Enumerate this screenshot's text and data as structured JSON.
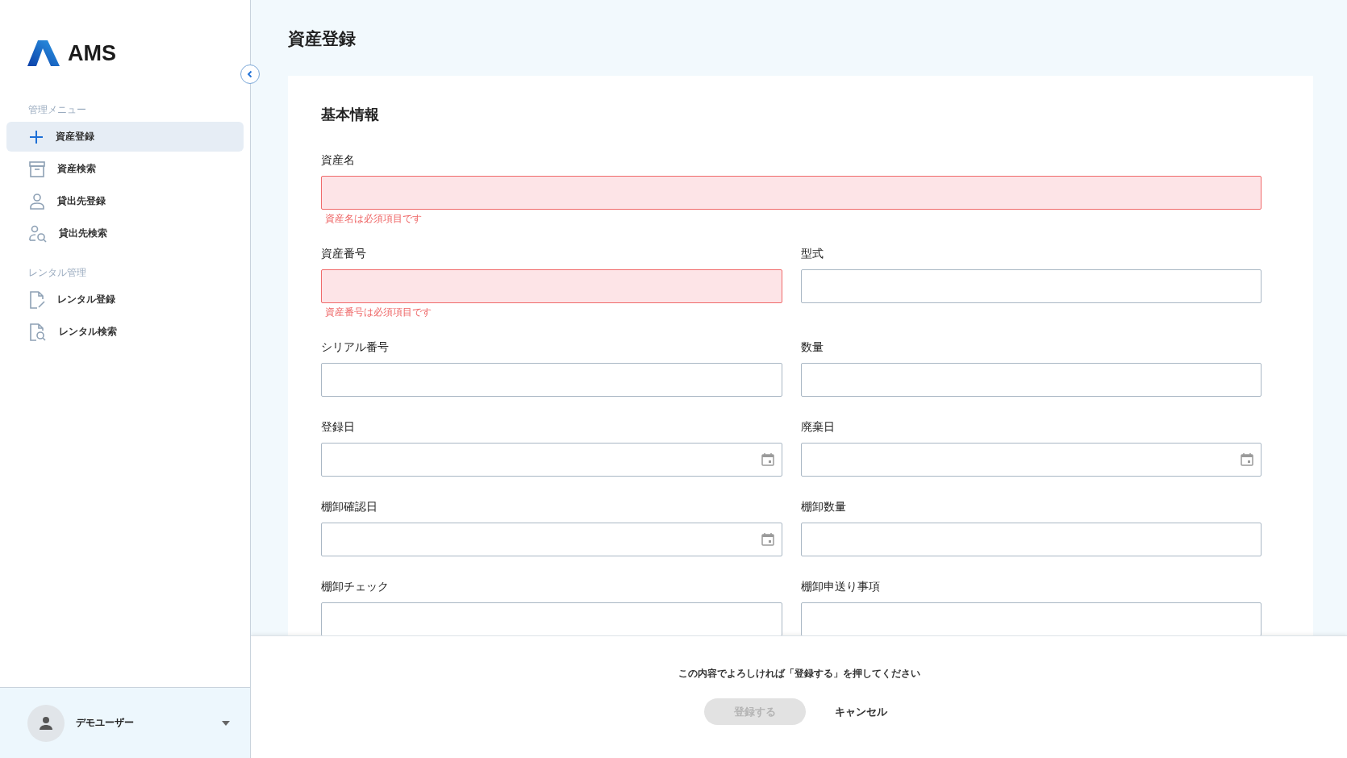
{
  "sidebar": {
    "logo": "AMS",
    "sections": [
      {
        "heading": "管理メニュー",
        "items": [
          {
            "label": "資産登録",
            "selected": true
          },
          {
            "label": "資産検索",
            "selected": false
          },
          {
            "label": "貸出先登録",
            "selected": false
          },
          {
            "label": "貸出先検索",
            "selected": false
          }
        ]
      },
      {
        "heading": "レンタル管理",
        "items": [
          {
            "label": "レンタル登録",
            "selected": false
          },
          {
            "label": "レンタル検索",
            "selected": false
          }
        ]
      }
    ],
    "user": {
      "name": "デモユーザー"
    }
  },
  "page": {
    "title": "資産登録"
  },
  "form": {
    "section_title": "基本情報",
    "rows": [
      [
        {
          "label": "資産名",
          "kind": "text",
          "invalid": true,
          "error": "資産名は必須項目です"
        }
      ],
      [
        {
          "label": "資産番号",
          "kind": "text",
          "invalid": true,
          "error": "資産番号は必須項目です"
        },
        {
          "label": "型式",
          "kind": "text",
          "invalid": false
        }
      ],
      [
        {
          "label": "シリアル番号",
          "kind": "text",
          "invalid": false
        },
        {
          "label": "数量",
          "kind": "text",
          "invalid": false
        }
      ],
      [
        {
          "label": "登録日",
          "kind": "date",
          "invalid": false
        },
        {
          "label": "廃棄日",
          "kind": "date",
          "invalid": false
        }
      ],
      [
        {
          "label": "棚卸確認日",
          "kind": "date",
          "invalid": false
        },
        {
          "label": "棚卸数量",
          "kind": "text",
          "invalid": false
        }
      ],
      [
        {
          "label": "棚卸チェック",
          "kind": "text",
          "invalid": false
        },
        {
          "label": "棚卸申送り事項",
          "kind": "text",
          "invalid": false
        }
      ]
    ]
  },
  "footer": {
    "message": "この内容でよろしければ「登録する」を押してください",
    "buttons": [
      {
        "label": "登録する",
        "kind": "primary",
        "disabled": true
      },
      {
        "label": "キャンセル",
        "kind": "text",
        "disabled": false
      }
    ]
  }
}
